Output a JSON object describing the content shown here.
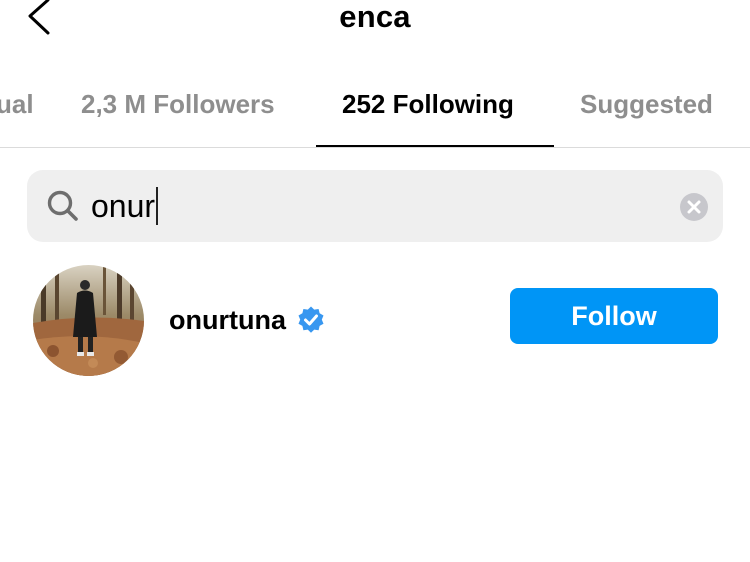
{
  "header": {
    "title": "enca",
    "back_icon": "chevron-left-icon"
  },
  "tabs": [
    {
      "label": "ual",
      "active": false
    },
    {
      "label": "2,3 M Followers",
      "active": false
    },
    {
      "label": "252 Following",
      "active": true
    },
    {
      "label": "Suggested",
      "active": false
    }
  ],
  "search": {
    "value": "onur",
    "icon": "search-icon",
    "clear_icon": "clear-icon"
  },
  "results": [
    {
      "username": "onurtuna",
      "verified": true,
      "action_label": "Follow"
    }
  ],
  "colors": {
    "accent": "#0095f6",
    "verified_badge": "#3897f0",
    "muted_text": "#8e8e8e",
    "search_bg": "#efefef",
    "divider": "#dbdbdb"
  }
}
